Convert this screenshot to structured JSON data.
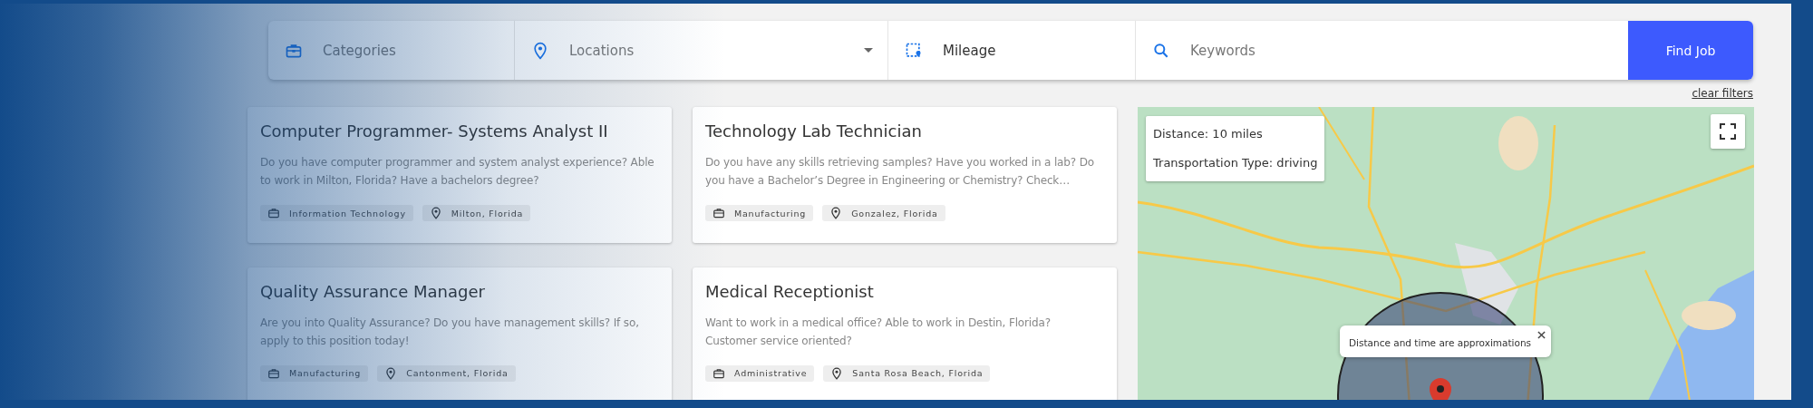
{
  "search": {
    "fields": [
      {
        "kind": "category",
        "placeholder": "Categories",
        "dropdown": false
      },
      {
        "kind": "location",
        "placeholder": "Locations",
        "dropdown": true
      },
      {
        "kind": "mileage",
        "value": "Mileage",
        "dropdown": false
      },
      {
        "kind": "keyword",
        "placeholder": "Keywords",
        "dropdown": false
      }
    ],
    "button": "Find Job",
    "clear_link": "clear filters"
  },
  "jobs": [
    {
      "title": "Computer Programmer- Systems Analyst II",
      "description": "Do you have computer programmer and system analyst experience? Able to work in Milton, Florida? Have a bachelors degree?",
      "category": "Information Technology",
      "location": "Milton, Florida"
    },
    {
      "title": "Technology Lab Technician",
      "description": "Do you have any skills retrieving samples? Have you worked in a lab? Do you have a Bachelor’s Degree in Engineering or Chemistry? Check…",
      "category": "Manufacturing",
      "location": "Gonzalez, Florida"
    },
    {
      "title": "Quality Assurance Manager",
      "description": "Are you into Quality Assurance? Do you have management skills? If so, apply to this position today!",
      "category": "Manufacturing",
      "location": "Cantonment, Florida"
    },
    {
      "title": "Medical Receptionist",
      "description": "Want to work in a medical office? Able to work in Destin, Florida? Customer service oriented?",
      "category": "Administrative",
      "location": "Santa Rosa Beach, Florida"
    }
  ],
  "map": {
    "info": [
      "Distance: 10 miles",
      "Transportation Type: driving"
    ],
    "popup": "Distance and time are approximations"
  }
}
